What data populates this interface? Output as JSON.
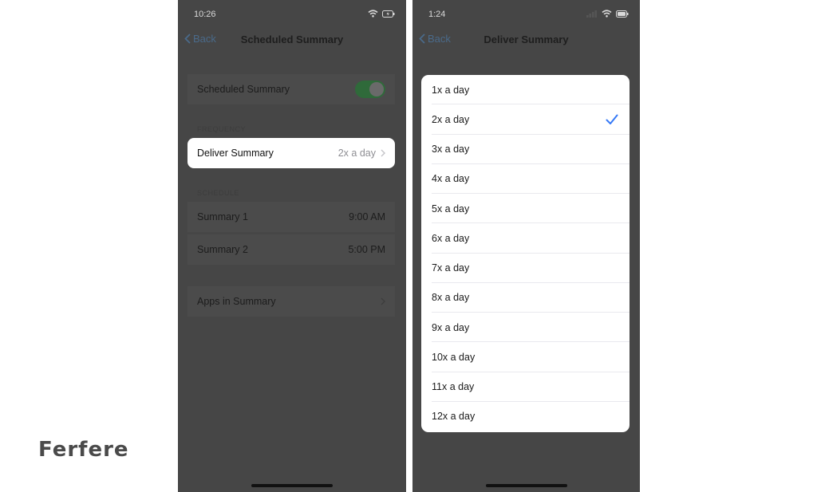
{
  "watermark": "Ferfere",
  "left_screen": {
    "time": "10:26",
    "back_label": "Back",
    "title": "Scheduled Summary",
    "toggle_row": {
      "label": "Scheduled Summary",
      "on": true
    },
    "frequency_header": "FREQUENCY",
    "deliver_row": {
      "label": "Deliver Summary",
      "value": "2x a day"
    },
    "schedule_header": "SCHEDULE",
    "schedule": [
      {
        "label": "Summary 1",
        "time": "9:00 AM"
      },
      {
        "label": "Summary 2",
        "time": "5:00 PM"
      }
    ],
    "apps_row": {
      "label": "Apps in Summary"
    }
  },
  "right_screen": {
    "time": "1:24",
    "back_label": "Back",
    "title": "Deliver Summary",
    "options": [
      "1x a day",
      "2x a day",
      "3x a day",
      "4x a day",
      "5x a day",
      "6x a day",
      "7x a day",
      "8x a day",
      "9x a day",
      "10x a day",
      "11x a day",
      "12x a day"
    ],
    "selected": "2x a day"
  },
  "colors": {
    "dim_background": "#464646",
    "accent": "#3478f6",
    "toggle_on": "#2f6a3a"
  }
}
